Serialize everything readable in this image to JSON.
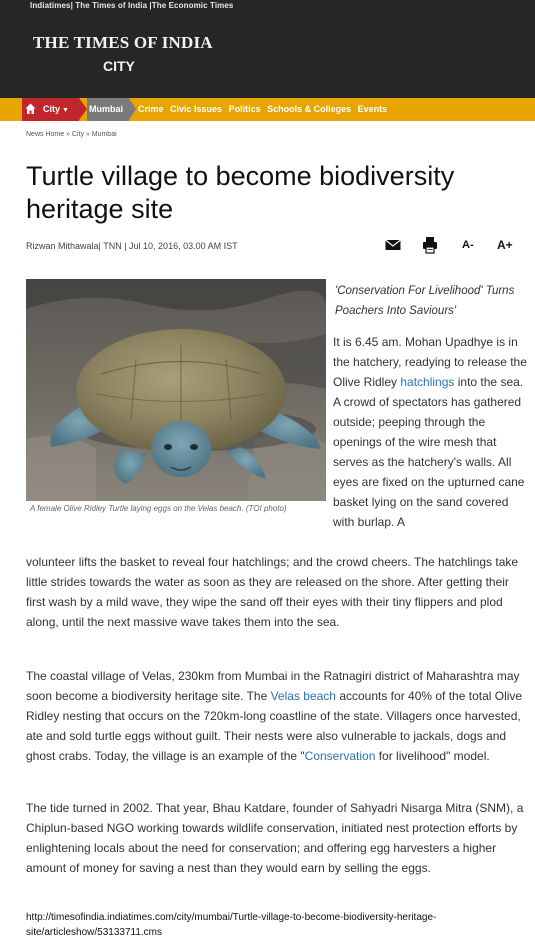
{
  "header": {
    "network_links": "Indiatimes| The Times of India |The Economic Times",
    "masthead": "THE TIMES OF INDIA",
    "section": "CITY"
  },
  "nav": {
    "city": "City",
    "mumbai": "Mumbai",
    "links": [
      "Crime",
      "Civic Issues",
      "Politics",
      "Schools & Colleges",
      "Events"
    ]
  },
  "breadcrumb": "News Home » City » Mumbai",
  "article": {
    "title": "Turtle village to become biodiversity heritage site",
    "byline": "Rizwan Mithawala| TNN | Jul 10, 2016, 03.00 AM IST",
    "font_decrease": "A-",
    "font_increase": "A+",
    "photo_caption": "A female Olive Ridley Turtle laying eggs on the Velas beach. (TOI photo)",
    "pull_quote": "'Conservation For Livelihood' Turns Poachers Into Saviours'",
    "p1_right": {
      "before": "It is 6.45 am. Mohan Upadhye is in the hatchery, readying to release the Olive Ridley ",
      "link": "hatchlings",
      "after": " into the sea. A crowd of spectators has gathered outside; peeping through the openings of the wire mesh that serves as the hatchery's walls. All eyes are fixed on the upturned cane basket lying on the sand covered with burlap. A"
    },
    "p1_full": "volunteer lifts the basket to reveal four hatchlings; and the crowd cheers. The hatchlings take little strides towards the water as soon as they are released on the shore. After getting their first wash by a mild wave, they wipe the sand off their eyes with their tiny flippers and plod along, until the next massive wave takes them into the sea.",
    "p2": {
      "before": "The coastal village of Velas, 230km from Mumbai in the Ratnagiri district of Maharashtra may soon become a biodiversity heritage site. The ",
      "link1": "Velas beach",
      "middle": " accounts for 40% of the total Olive Ridley nesting that occurs on the 720km-long coastline of the state. Villagers once harvested, ate and sold turtle eggs without guilt. Their nests were also vulnerable to jackals, dogs and ghost crabs. Today, the village is an example of the \"",
      "link2": "Conservation",
      "after": " for livelihood\" model."
    },
    "p3": "The tide turned in 2002. That year, Bhau Katdare, founder of Sahyadri Nisarga Mitra (SNM), a Chiplun-based NGO working towards wildlife conservation, initiated nest protection efforts by enlightening locals about the need for conservation; and offering egg harvesters a higher amount of money for saving a nest than they would earn by selling the eggs."
  },
  "source_url": "http://timesofindia.indiatimes.com/city/mumbai/Turtle-village-to-become-biodiversity-heritage-site/articleshow/53133711.cms",
  "icons": {
    "home": "home-icon",
    "mail": "mail-icon",
    "print": "print-icon"
  },
  "colors": {
    "header_bg": "#262626",
    "nav_bg": "#e8a400",
    "nav_active": "#c0272d",
    "link": "#2b74b4"
  }
}
